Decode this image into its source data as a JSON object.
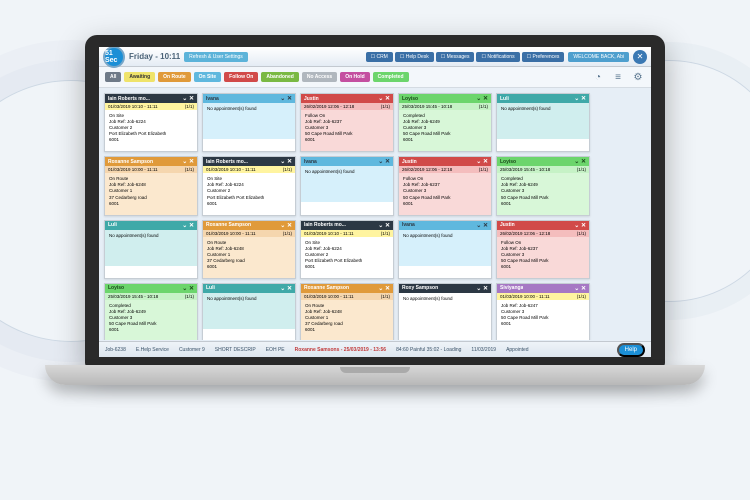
{
  "header": {
    "countdown": "51 Sec",
    "title": "Friday - 10:11",
    "refresh": "Refresh & User Settings",
    "topButtons": [
      "CRM",
      "Help Desk",
      "Messages",
      "Notifications",
      "Preferences"
    ],
    "welcome": "WELCOME BACK, Abi"
  },
  "statuses": [
    {
      "label": "All",
      "cls": "s-all"
    },
    {
      "label": "Awaiting",
      "cls": "s-awaiting"
    },
    {
      "label": "On Route",
      "cls": "s-onroute"
    },
    {
      "label": "On Site",
      "cls": "s-onsite"
    },
    {
      "label": "Follow On",
      "cls": "s-followon"
    },
    {
      "label": "Abandoned",
      "cls": "s-abandoned"
    },
    {
      "label": "No Access",
      "cls": "s-noaccess"
    },
    {
      "label": "On Hold",
      "cls": "s-onhold"
    },
    {
      "label": "Completed",
      "cls": "s-completed"
    }
  ],
  "cards": [
    {
      "name": "Iain Roberts mo...",
      "head": "ch-dark",
      "time": "01/03/2019 10:10 - 11:11",
      "tcl": "ct-yellow",
      "count": "(1/1)",
      "body": "On Site\nJob Ref: Job-6224\nCustomer 2\nPort Elizabeth Port Elizabeth\n6001",
      "bcl": ""
    },
    {
      "name": "Ivana",
      "head": "ch-blue",
      "time": "",
      "tcl": "",
      "count": "",
      "body": "No appointment(s) found",
      "bcl": "cb-blue"
    },
    {
      "name": "Justin",
      "head": "ch-red",
      "time": "26/02/2019 12:06 - 12:18",
      "tcl": "ct-red",
      "count": "(1/1)",
      "body": "Follow On\nJob Ref: Job-6237\nCustomer 3\n50 Cape Road Mill Park\n6001",
      "bcl": "cb-red"
    },
    {
      "name": "Loyiso",
      "head": "ch-green",
      "time": "25/03/2019 15:45 - 10:18",
      "tcl": "ct-green",
      "count": "(1/1)",
      "body": "Completed\nJob Ref: Job-6249\nCustomer 3\n50 Cape Road Mill Park\n6001",
      "bcl": "cb-green"
    },
    {
      "name": "Luli",
      "head": "ch-teal",
      "time": "",
      "tcl": "",
      "count": "",
      "body": "No appointment(s) found",
      "bcl": "cb-teal"
    },
    {
      "name": "Roxanne Sampson",
      "head": "ch-orange",
      "time": "01/03/2019 10:00 - 11:11",
      "tcl": "ct-orange",
      "count": "(1/1)",
      "body": "On Route\nJob Ref: Job-6248\nCustomer 1\n37 Cedarberg road\n6001",
      "bcl": "cb-orange"
    },
    {
      "name": "Iain Roberts mo...",
      "head": "ch-dark",
      "time": "01/03/2019 10:10 - 11:11",
      "tcl": "ct-yellow",
      "count": "(1/1)",
      "body": "On Site\nJob Ref: Job-6224\nCustomer 2\nPort Elizabeth Port Elizabeth\n6001",
      "bcl": ""
    },
    {
      "name": "Ivana",
      "head": "ch-blue",
      "time": "",
      "tcl": "",
      "count": "",
      "body": "No appointment(s) found",
      "bcl": "cb-blue"
    },
    {
      "name": "Justin",
      "head": "ch-red",
      "time": "26/02/2019 12:06 - 12:18",
      "tcl": "ct-red",
      "count": "(1/1)",
      "body": "Follow On\nJob Ref: Job-6237\nCustomer 3\n50 Cape Road Mill Park\n6001",
      "bcl": "cb-red"
    },
    {
      "name": "Loyiso",
      "head": "ch-green",
      "time": "25/03/2019 15:45 - 10:18",
      "tcl": "ct-green",
      "count": "(1/1)",
      "body": "Completed\nJob Ref: Job-6249\nCustomer 3\n50 Cape Road Mill Park\n6001",
      "bcl": "cb-green"
    },
    {
      "name": "Luli",
      "head": "ch-teal",
      "time": "",
      "tcl": "",
      "count": "",
      "body": "No appointment(s) found",
      "bcl": "cb-teal"
    },
    {
      "name": "Roxanne Sampson",
      "head": "ch-orange",
      "time": "01/03/2019 10:00 - 11:11",
      "tcl": "ct-orange",
      "count": "(1/1)",
      "body": "On Route\nJob Ref: Job-6248\nCustomer 1\n37 Cedarberg road\n6001",
      "bcl": "cb-orange"
    },
    {
      "name": "Iain Roberts mo...",
      "head": "ch-dark",
      "time": "01/03/2019 10:10 - 11:11",
      "tcl": "ct-yellow",
      "count": "(1/1)",
      "body": "On Site\nJob Ref: Job-6224\nCustomer 2\nPort Elizabeth Port Elizabeth\n6001",
      "bcl": ""
    },
    {
      "name": "Ivana",
      "head": "ch-blue",
      "time": "",
      "tcl": "",
      "count": "",
      "body": "No appointment(s) found",
      "bcl": "cb-blue"
    },
    {
      "name": "Justin",
      "head": "ch-red",
      "time": "26/02/2019 12:06 - 12:18",
      "tcl": "ct-red",
      "count": "(1/1)",
      "body": "Follow On\nJob Ref: Job-6237\nCustomer 3\n50 Cape Road Mill Park\n6001",
      "bcl": "cb-red"
    },
    {
      "name": "Loyiso",
      "head": "ch-green",
      "time": "25/03/2019 15:45 - 10:18",
      "tcl": "ct-green",
      "count": "(1/1)",
      "body": "Completed\nJob Ref: Job-6249\nCustomer 3\n50 Cape Road Mill Park\n6001",
      "bcl": "cb-green"
    },
    {
      "name": "Luli",
      "head": "ch-teal",
      "time": "",
      "tcl": "",
      "count": "",
      "body": "No appointment(s) found",
      "bcl": "cb-teal"
    },
    {
      "name": "Roxanne Sampson",
      "head": "ch-orange",
      "time": "01/03/2019 10:00 - 11:11",
      "tcl": "ct-orange",
      "count": "(1/1)",
      "body": "On Route\nJob Ref: Job-6248\nCustomer 1\n37 Cedarberg road\n6001",
      "bcl": "cb-orange"
    },
    {
      "name": "Roxy Sampson",
      "head": "ch-dark",
      "time": "",
      "tcl": "",
      "count": "",
      "body": "No appointment(s) found",
      "bcl": ""
    },
    {
      "name": "Siviyanga",
      "head": "ch-purple",
      "time": "01/03/2019 10:00 - 11:11",
      "tcl": "ct-yellow",
      "count": "(1/1)",
      "body": "Job Ref: Job-6247\nCustomer 3\n50 Cape Road Mill Park\n6001",
      "bcl": ""
    }
  ],
  "footer": {
    "left": [
      "Job-6238",
      "E.Help Service",
      "Customer 9",
      "SHORT DESCRIP",
      "EOH PE"
    ],
    "alert": "Roxanne Samsons - 25/03/2019 - 13:56",
    "sub": "84:60 Painful  35:02 - Loading",
    "date": "11/03/2019",
    "type": "Appointed",
    "help": "Help"
  }
}
